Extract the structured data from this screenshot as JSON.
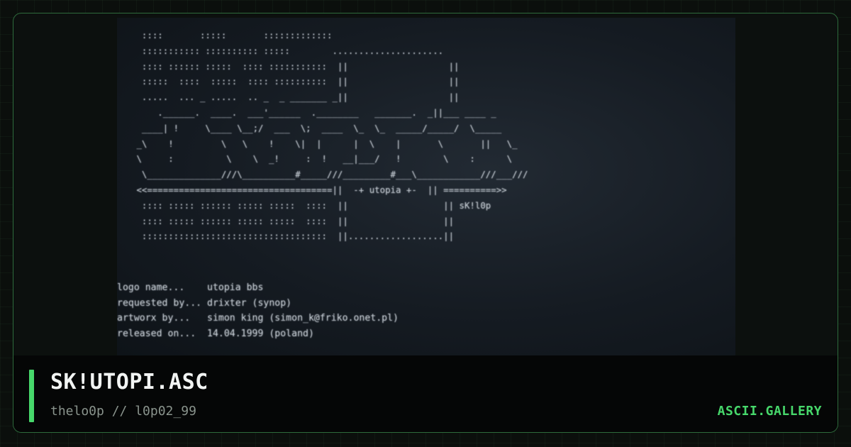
{
  "preview": {
    "art_lines": [
      "  ::::       :::::       :::::::::::::",
      "  ::::::::::: :::::::::: :::::        ..................... ",
      "  :::: :::::: :::::  :::: :::::::::::  ||                   ||",
      "  :::::  ::::  :::::  :::: ::::::::::  ||                   ||",
      "  .....  ... _ .....  .. _  _ _______ _||                   ||",
      "     .______.  ____.  ___'______  .________   _______.  _||___ ____ _",
      "  ____| !     \\____ \\__;/  ___  \\;  ____  \\_  \\_  _____/_____/  \\_____",
      " _\\    !         \\   \\    !    \\|  |      |  \\    |       \\       ||   \\_",
      " \\     :          \\    \\  _!     :  !   __|___/   !        \\    :      \\",
      "  \\______________///\\__________#_____///_________#___\\____________///___///",
      " <<===================================||  -+ utopia +-  || ==========>>",
      "  :::: ::::: :::::: ::::: :::::  ::::  ||                  || sK!l0p",
      "  :::: ::::: :::::: ::::: :::::  ::::  ||                  ||",
      "  :::::::::::::::::::::::::::::::::::  ||..................||"
    ],
    "info_lines": [
      "logo name...    utopia bbs",
      "requested by... drixter (synop)",
      "artworx by...   simon king (simon_k@friko.onet.pl)",
      "released on...  14.04.1999 (poland)"
    ]
  },
  "footer": {
    "title": "SK!UTOPI.ASC",
    "subtitle": "thelo0p // l0p02_99",
    "brand": "ASCII.GALLERY"
  },
  "colors": {
    "accent": "#47d86b",
    "border": "#2e6b3c",
    "background": "#0b0f0c",
    "footer_bg": "#050606"
  }
}
